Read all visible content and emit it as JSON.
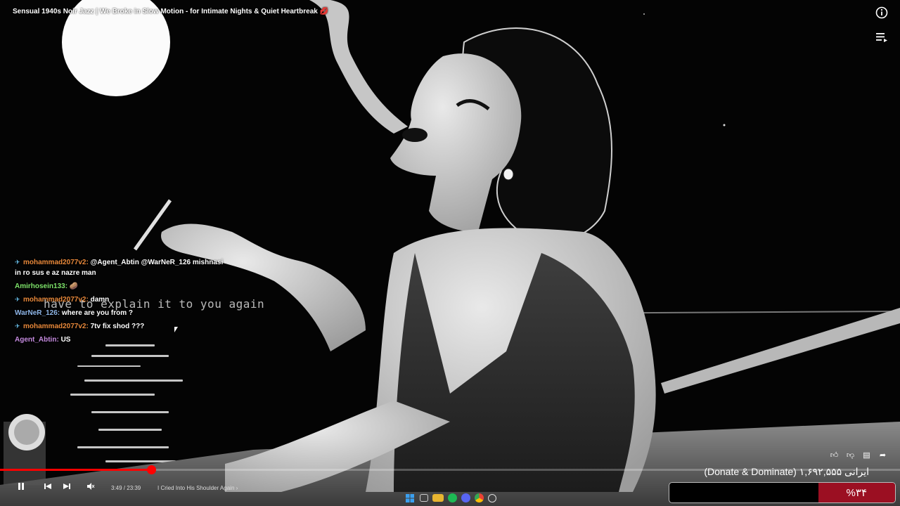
{
  "video": {
    "title": "Sensual 1940s Noir Jazz | We Broke in Slow Motion - for Intimate Nights & Quiet Heartbreak",
    "title_emoji": "💋",
    "lyric_overlay": "have to explain it to you again",
    "current_time": "3:49 / 23:39",
    "chapter": "I Cried Into His Shoulder Again",
    "progress": 0.168
  },
  "chat": [
    {
      "user": "mohammad2077v2:",
      "user_color": "#e8883a",
      "pinned": true,
      "message": "@Agent_Abtin @WarNeR_126 mishnasi"
    },
    {
      "user": "",
      "user_color": "#ffffff",
      "pinned": false,
      "message": "in ro sus e az nazre man"
    },
    {
      "user": "Amirhosein133:",
      "user_color": "#7ee36a",
      "pinned": false,
      "message": "🥔"
    },
    {
      "user": "mohammad2077v2:",
      "user_color": "#e8883a",
      "pinned": true,
      "message": "damn"
    },
    {
      "user": "WarNeR_126:",
      "user_color": "#8fb6e8",
      "pinned": false,
      "message": "where are you from ?"
    },
    {
      "user": "mohammad2077v2:",
      "user_color": "#e8883a",
      "pinned": true,
      "message": "7tv fix shod ???"
    },
    {
      "user": "Agent_Abtin:",
      "user_color": "#c58bdf",
      "pinned": false,
      "message": "US"
    }
  ],
  "donate": {
    "label": "(Donate & Dominate) ۱,۶۹۲,۵۵۵ ایرانی",
    "percent_text": "%۳۴",
    "percent": 0.34
  },
  "colors": {
    "accent": "#ff0000",
    "donate_bar": "#9b0f22"
  },
  "icons": {
    "info": "info-icon",
    "playlist": "playlist-icon",
    "like": "thumbs-up-icon",
    "dislike": "thumbs-down-icon",
    "comment": "comment-icon",
    "share": "share-icon"
  }
}
